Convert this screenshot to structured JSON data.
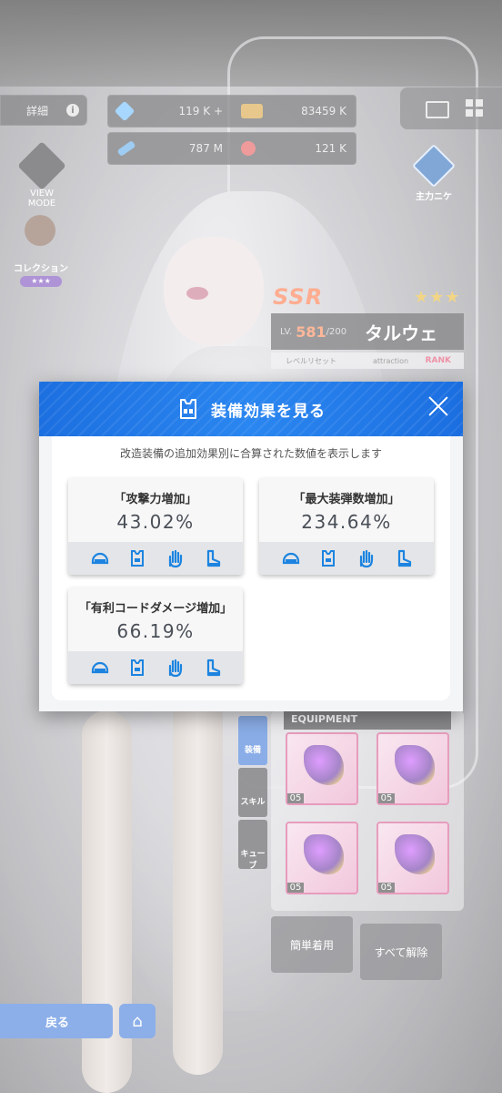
{
  "hud": {
    "detail_label": "詳細",
    "info_glyph": "i",
    "resource1_value": "119 K",
    "resource1_plus": "+",
    "resource2_value": "83459 K",
    "resource3_value": "787 M",
    "resource4_value": "121 K",
    "view_mode_label": "VIEW MODE",
    "collection_label": "コレクション",
    "collection_stars": "★★★",
    "right_label": "主力ニケ"
  },
  "character": {
    "rarity": "SSR",
    "stars": "★★★",
    "level_prefix": "LV.",
    "level": "581",
    "level_max": "/200",
    "name": "タルウェ",
    "reset_label": "レベルリセット",
    "attraction_label": "attraction",
    "rank_label": "RANK"
  },
  "equipment": {
    "header": "EQUIPMENT",
    "slot_levels": [
      "05",
      "05",
      "05",
      "05"
    ]
  },
  "side_tabs": [
    "装備",
    "スキル",
    "キューブ"
  ],
  "buttons": {
    "quick_equip": "簡単着用",
    "unequip_all": "すべて解除",
    "back": "戻る"
  },
  "modal": {
    "title": "装備効果を見る",
    "description": "改造装備の追加効果別に合算された数値を表示します",
    "cards": [
      {
        "label": "「攻撃力増加」",
        "value": "43.02%"
      },
      {
        "label": "「最大装弾数増加」",
        "value": "234.64%"
      },
      {
        "label": "「有利コードダメージ増加」",
        "value": "66.19%"
      }
    ],
    "accent_color": "#1c7fe0",
    "icon_names": [
      "helmet-icon",
      "armor-vest-icon",
      "glove-icon",
      "boots-icon"
    ]
  }
}
